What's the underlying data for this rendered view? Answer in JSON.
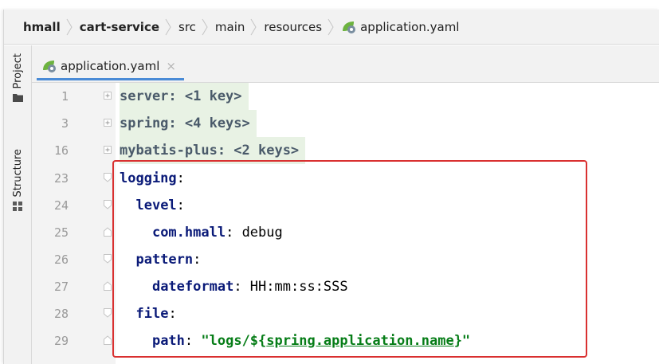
{
  "breadcrumb": {
    "items": [
      "hmall",
      "cart-service",
      "src",
      "main",
      "resources",
      "application.yaml"
    ]
  },
  "toolwindows": {
    "project_label": "Project",
    "structure_label": "Structure"
  },
  "editor_tab": {
    "label": "application.yaml",
    "close": "×"
  },
  "lines": [
    {
      "num": "1",
      "text": "server: <1 key>"
    },
    {
      "num": "3",
      "text": "spring: <4 keys>"
    },
    {
      "num": "16",
      "text": "mybatis-plus: <2 keys>"
    },
    {
      "num": "23",
      "key": "logging",
      "colon": ":"
    },
    {
      "num": "24",
      "indent": "  ",
      "key": "level",
      "colon": ":"
    },
    {
      "num": "25",
      "indent": "    ",
      "key": "com.hmall",
      "colon": ": ",
      "value": "debug"
    },
    {
      "num": "26",
      "indent": "  ",
      "key": "pattern",
      "colon": ":"
    },
    {
      "num": "27",
      "indent": "    ",
      "key": "dateformat",
      "colon": ": ",
      "value": "HH:mm:ss:SSS"
    },
    {
      "num": "28",
      "indent": "  ",
      "key": "file",
      "colon": ":"
    },
    {
      "num": "29",
      "indent": "    ",
      "key": "path",
      "colon": ": ",
      "str_open": "\"logs/${",
      "str_ref": "spring.application.name",
      "str_close": "}\""
    }
  ],
  "colors": {
    "key": "#0a1a78",
    "string": "#067d17",
    "highlight_border": "#d93030",
    "tab_underline": "#4a8bd6"
  }
}
